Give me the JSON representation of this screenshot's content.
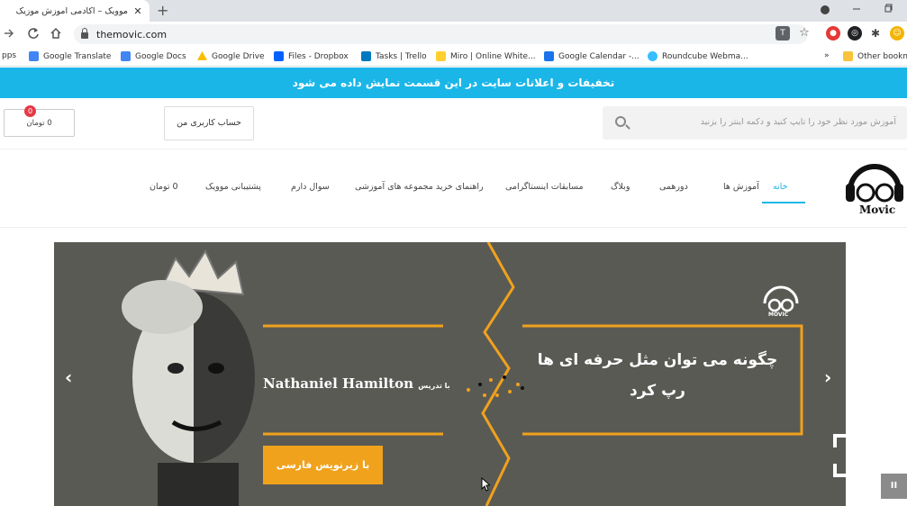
{
  "browser": {
    "tab_title": "موویک – آکادمی آموزش موزیک",
    "tab_close": "✕",
    "new_tab": "+",
    "url": "themovic.com",
    "bookmarks": [
      {
        "label": "pps",
        "color": "#5f6368"
      },
      {
        "label": "Google Translate",
        "color": "#4285f4"
      },
      {
        "label": "Google Docs",
        "color": "#4285f4"
      },
      {
        "label": "Google Drive",
        "color": "#fbbc04"
      },
      {
        "label": "Files - Dropbox",
        "color": "#0061ff"
      },
      {
        "label": "Tasks | Trello",
        "color": "#0079bf"
      },
      {
        "label": "Miro | Online White...",
        "color": "#ffd02f"
      },
      {
        "label": "Google Calendar -...",
        "color": "#1a73e8"
      },
      {
        "label": "Roundcube Webma...",
        "color": "#37beff"
      }
    ],
    "bookmarks_overflow": "»",
    "other_bookmarks": "Other bookm"
  },
  "site": {
    "announcement": "تخفیفات و اعلانات سایت در این قسمت نمایش داده می شود",
    "cart_label": "0 تومان",
    "cart_count": "0",
    "account_label": "حساب کاربری من",
    "search_placeholder": "آموزش مورد نظر خود را تایپ کنید و دکمه اینتر را بزنید",
    "nav": [
      {
        "label": "خانه",
        "active": true
      },
      {
        "label": "آموزش ها"
      },
      {
        "label": "دورهمی"
      },
      {
        "label": "وبلاگ"
      },
      {
        "label": "مسابقات اینستاگرامی"
      },
      {
        "label": "راهنمای خرید مجموعه های آموزشی"
      },
      {
        "label": "سوال دارم"
      },
      {
        "label": "پشتیبانی موویک"
      },
      {
        "label": "0 تومان"
      }
    ],
    "logo_text": "Movic"
  },
  "banner": {
    "logo_text": "MOVIC",
    "headline_line1": "چگونه می توان  مثل حرفه ای ها",
    "headline_line2": "رپ کرد",
    "instructor_prefix": "با تدریس",
    "instructor_name": "Nathaniel Hamilton",
    "subtitle_button": "با زیرنویس فارسی",
    "prev_arrow": "‹",
    "next_arrow": "›",
    "pause_label": "II",
    "accent_color": "#f0a21c"
  }
}
